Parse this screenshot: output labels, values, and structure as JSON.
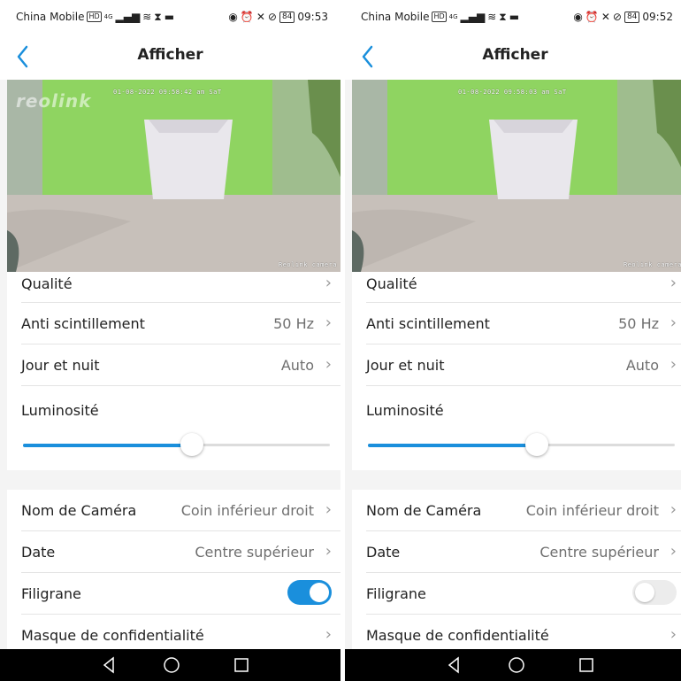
{
  "screens": [
    {
      "status": {
        "carrier": "China Mobile",
        "hd": "HD",
        "net": "4G",
        "battery": "84",
        "time": "09:53"
      },
      "header": {
        "title": "Afficher"
      },
      "video": {
        "timestamp": "01-08-2022 09:58:42 am SaT",
        "camera_name": "Reolink camera",
        "brand": "reolink"
      },
      "rows": [
        {
          "label": "Qualité",
          "value": ""
        },
        {
          "label": "Anti scintillement",
          "value": "50 Hz"
        },
        {
          "label": "Jour et nuit",
          "value": "Auto"
        }
      ],
      "luminosity": {
        "label": "Luminosité",
        "level": 0.55
      },
      "rows2": [
        {
          "label": "Nom de Caméra",
          "value": "Coin inférieur droit"
        },
        {
          "label": "Date",
          "value": "Centre supérieur"
        }
      ],
      "watermark": {
        "label": "Filigrane",
        "on": true
      },
      "privacy": {
        "label": "Masque de confidentialité"
      }
    },
    {
      "status": {
        "carrier": "China Mobile",
        "hd": "HD",
        "net": "4G",
        "battery": "84",
        "time": "09:52"
      },
      "header": {
        "title": "Afficher"
      },
      "video": {
        "timestamp": "01-08-2022 09:58:03 am SaT",
        "camera_name": "Reolink camera",
        "brand": ""
      },
      "rows": [
        {
          "label": "Qualité",
          "value": ""
        },
        {
          "label": "Anti scintillement",
          "value": "50 Hz"
        },
        {
          "label": "Jour et nuit",
          "value": "Auto"
        }
      ],
      "luminosity": {
        "label": "Luminosité",
        "level": 0.55
      },
      "rows2": [
        {
          "label": "Nom de Caméra",
          "value": "Coin inférieur droit"
        },
        {
          "label": "Date",
          "value": "Centre supérieur"
        }
      ],
      "watermark": {
        "label": "Filigrane",
        "on": false
      },
      "privacy": {
        "label": "Masque de confidentialité"
      }
    }
  ],
  "icons": {
    "back": "chevron-left-icon",
    "row_arrow": "chevron-right-icon",
    "nav": [
      "back-triangle-icon",
      "home-circle-icon",
      "recents-square-icon"
    ]
  },
  "colors": {
    "accent": "#1a8fdc",
    "background": "#f4f4f4",
    "navbar": "#000000"
  }
}
